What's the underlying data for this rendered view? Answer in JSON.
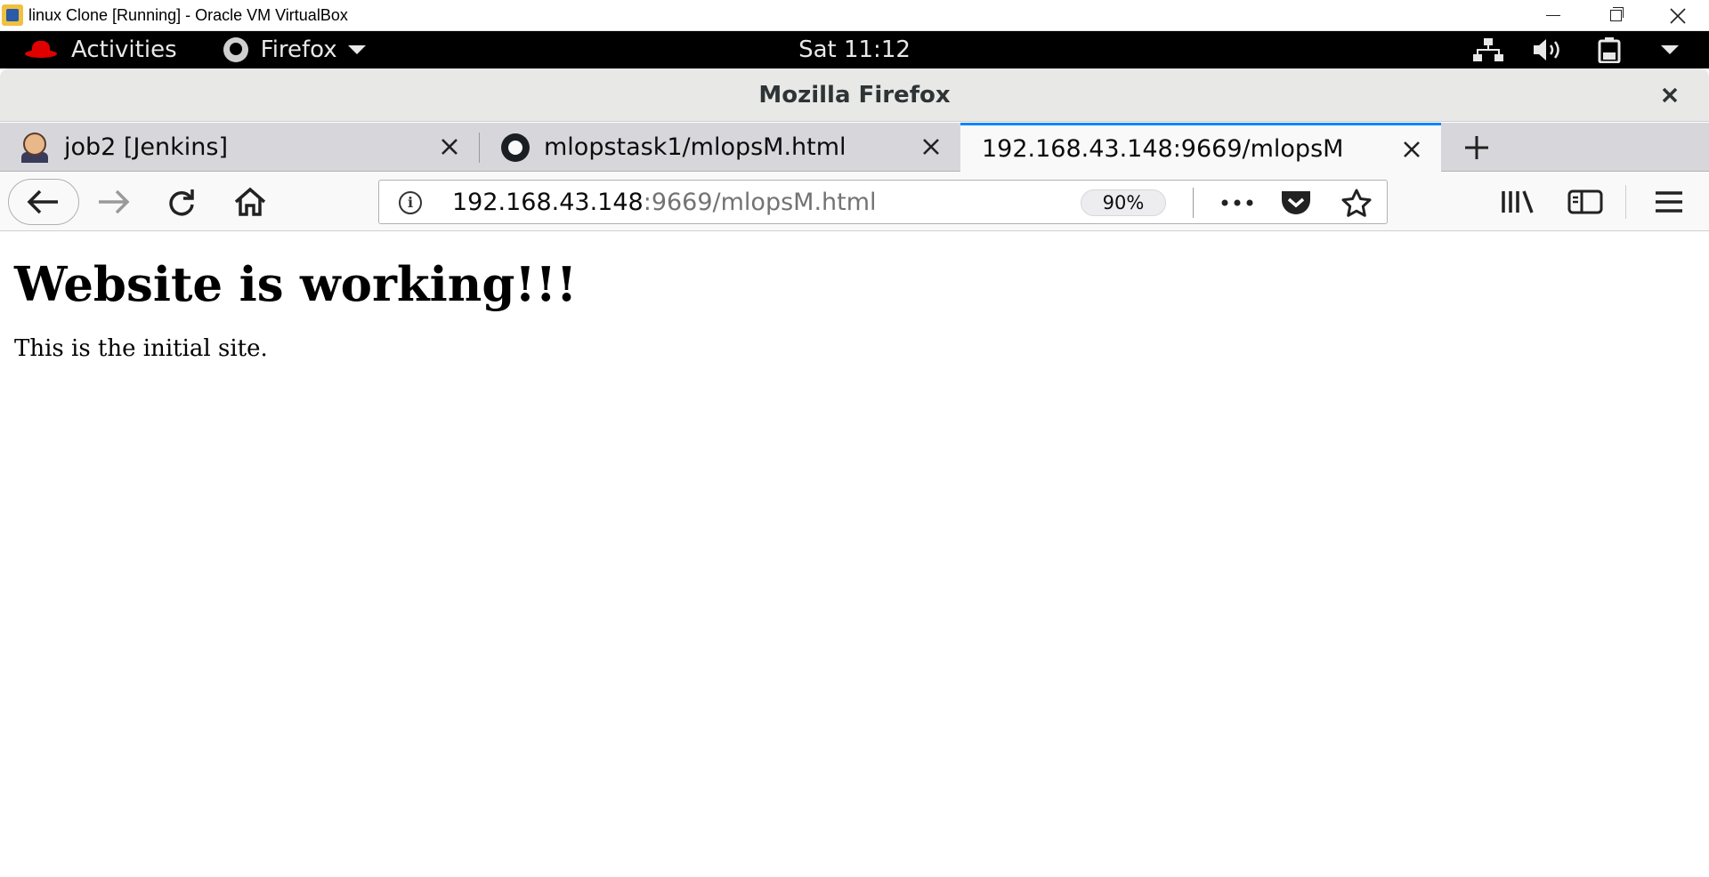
{
  "host_window": {
    "title": "linux Clone [Running] - Oracle VM VirtualBox"
  },
  "gnome_bar": {
    "activities_label": "Activities",
    "app_label": "Firefox",
    "clock": "Sat 11:12"
  },
  "firefox_window": {
    "title": "Mozilla Firefox"
  },
  "tabs": [
    {
      "label": "job2 [Jenkins]",
      "icon": "jenkins-icon",
      "active": false
    },
    {
      "label": "mlopstask1/mlopsM.html",
      "icon": "github-icon",
      "active": false
    },
    {
      "label": "192.168.43.148:9669/mlopsM",
      "icon": "none",
      "active": true
    }
  ],
  "urlbar": {
    "host": "192.168.43.148",
    "rest": ":9669/mlopsM.html",
    "zoom": "90%"
  },
  "page": {
    "heading": "Website is working!!!",
    "paragraph": "This is the initial site."
  },
  "colors": {
    "accent": "#0a84ff",
    "redhat": "#e00000",
    "gnome_bar": "#000000",
    "tabstrip": "#d7d7db"
  }
}
